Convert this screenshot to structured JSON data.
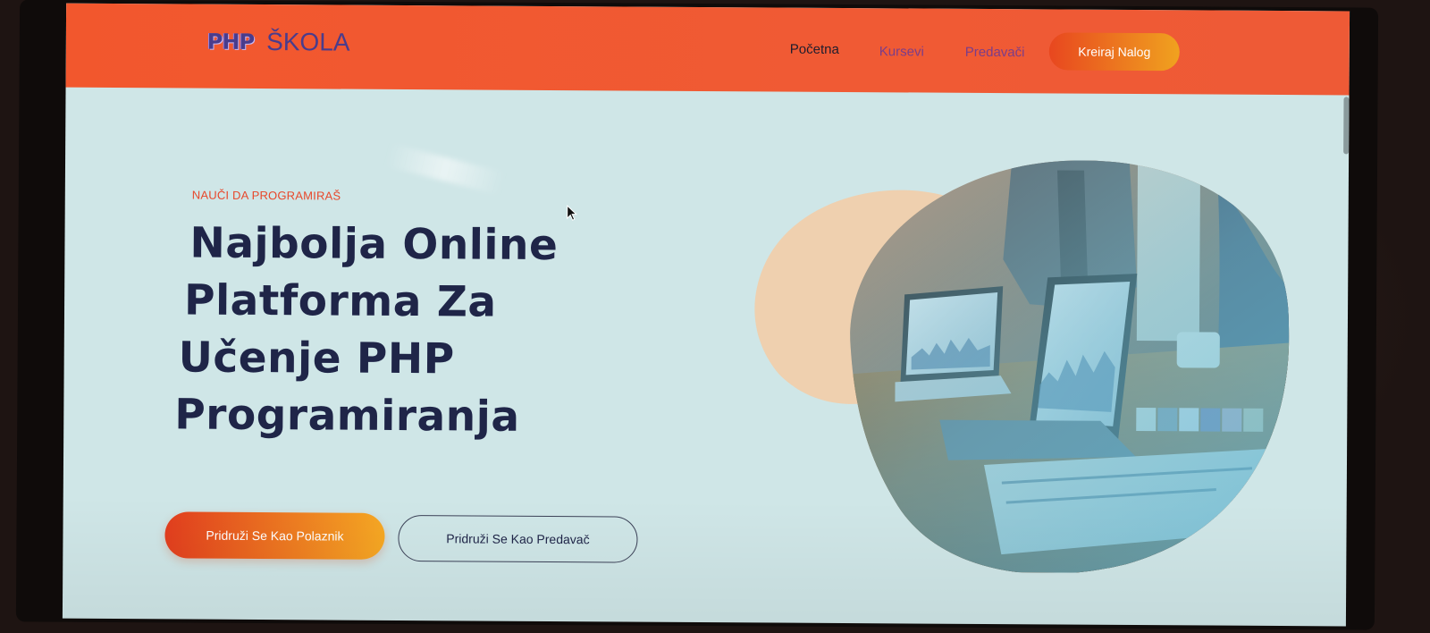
{
  "brand": {
    "logo_mark": "PHP",
    "name": "ŠKOLA"
  },
  "nav": {
    "items": [
      {
        "label": "Početna"
      },
      {
        "label": "Kursevi"
      },
      {
        "label": "Predavači"
      }
    ],
    "cta_label": "Kreiraj Nalog"
  },
  "hero": {
    "eyebrow": "NAUČI DA PROGRAMIRAŠ",
    "title_lines": [
      "Najbolja Online",
      "Platforma Za",
      "Učenje PHP",
      "Programiranja"
    ],
    "primary_button": "Pridruži Se Kao Polaznik",
    "secondary_button": "Pridruži Se Kao Predavač"
  },
  "colors": {
    "navbar": "#f2572d",
    "hero_bg": "#cfe6e7",
    "title": "#1f2548",
    "accent": "#e8472a",
    "brand": "#4a3c8c"
  },
  "icons": {
    "cursor": "arrow-cursor-icon"
  }
}
